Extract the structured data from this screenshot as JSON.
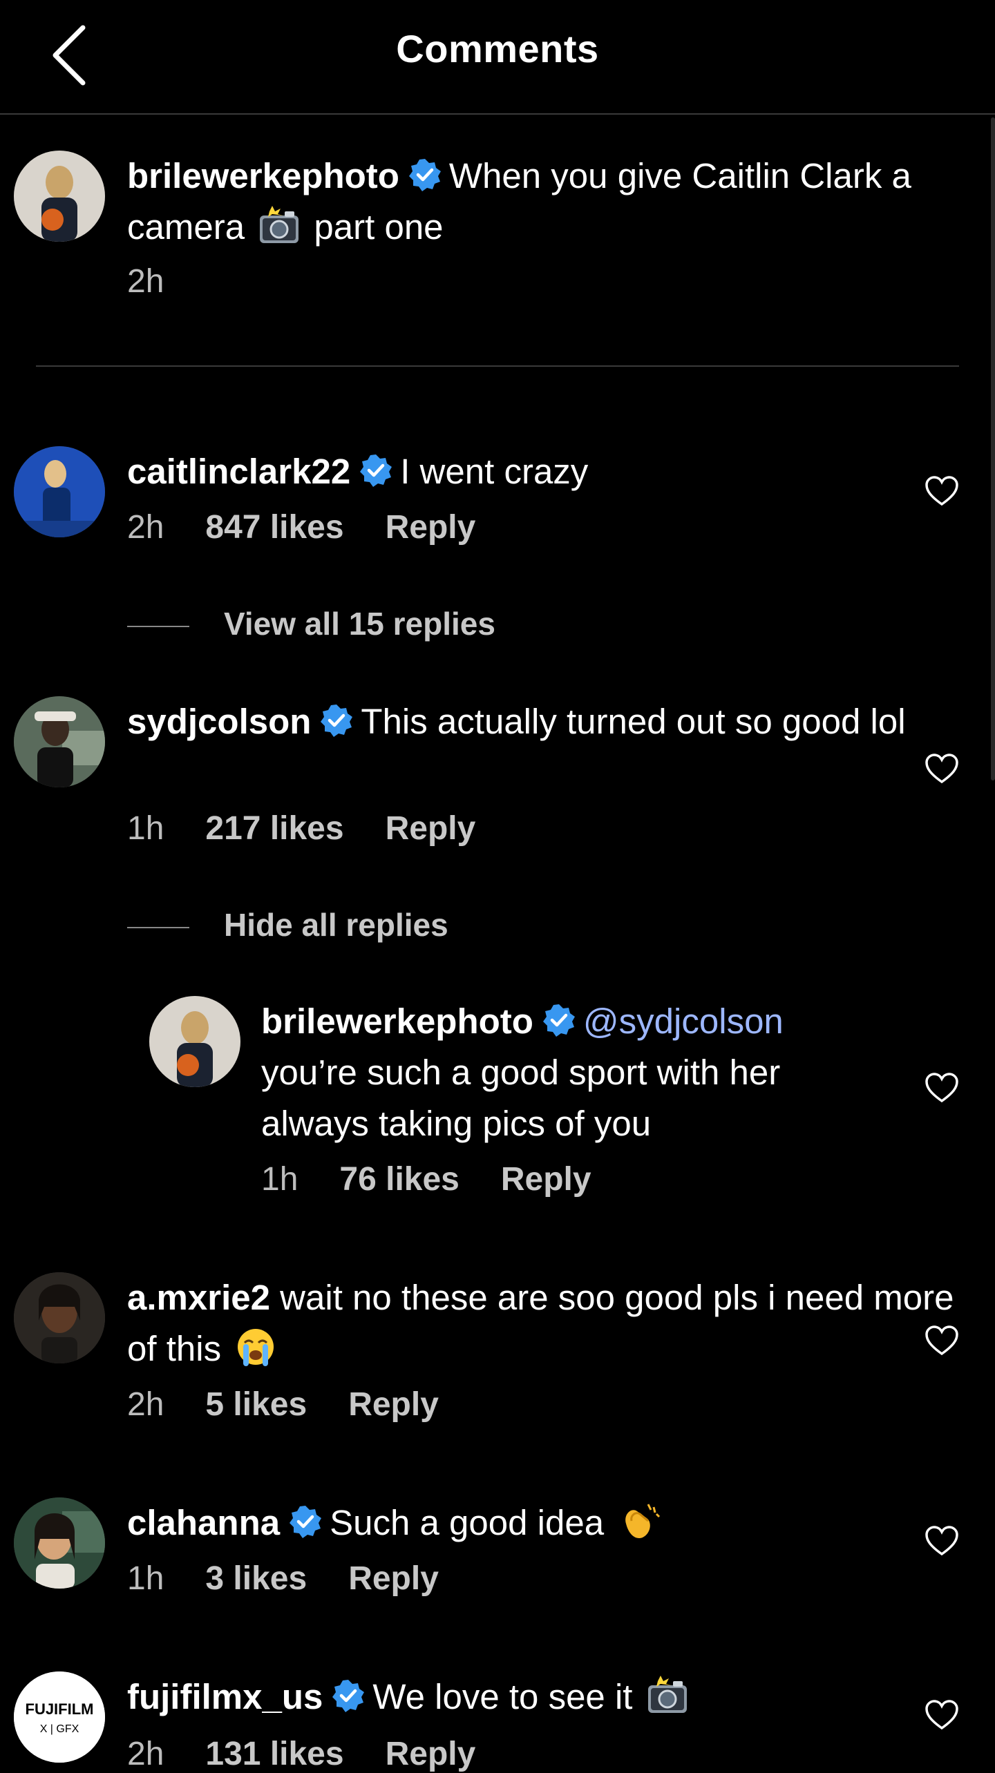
{
  "header": {
    "title": "Comments"
  },
  "caption": {
    "username": "brilewerkephoto",
    "text_a": "When you give Caitlin Clark a camera",
    "text_b": "part one",
    "time": "2h"
  },
  "comments": [
    {
      "username": "caitlinclark22",
      "text": "I went crazy",
      "time": "2h",
      "likes": "847 likes",
      "reply": "Reply",
      "replies_toggle": "View all 15 replies"
    },
    {
      "username": "sydjcolson",
      "text": "This actually turned out so good lol",
      "time": "1h",
      "likes": "217 likes",
      "reply": "Reply",
      "replies_toggle": "Hide all replies"
    },
    {
      "username": "brilewerkephoto",
      "mention": "@sydjcolson",
      "text": "you’re such a good sport with her always taking pics of you",
      "time": "1h",
      "likes": "76 likes",
      "reply": "Reply"
    },
    {
      "username": "a.mxrie2",
      "text": "wait no these are soo good pls i need more of this",
      "time": "2h",
      "likes": "5 likes",
      "reply": "Reply"
    },
    {
      "username": "clahanna",
      "text": "Such a good idea",
      "time": "1h",
      "likes": "3 likes",
      "reply": "Reply"
    },
    {
      "username": "fujifilmx_us",
      "text": "We love to see it",
      "time": "2h",
      "likes": "131 likes",
      "reply": "Reply"
    }
  ],
  "fuji_logo": {
    "line1": "FUJIFILM",
    "line2": "X | GFX"
  },
  "colors": {
    "background": "#000000",
    "verified": "#3897f0",
    "mention": "#9db7ff",
    "meta": "#bdbdbd"
  },
  "icons": [
    "back-chevron-icon",
    "verified-badge-icon",
    "heart-icon",
    "camera-emoji-icon",
    "crying-emoji-icon",
    "clapping-emoji-icon"
  ]
}
